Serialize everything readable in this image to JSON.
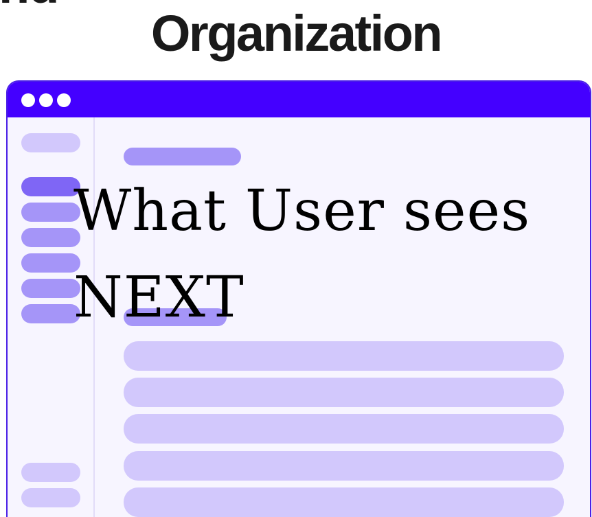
{
  "heading": {
    "cut_off_line": "nd",
    "title": "Organization"
  },
  "overlay": {
    "line1": "What User sees",
    "line2": "NEXT"
  },
  "colors": {
    "titlebar": "#4400ff",
    "window_border": "#4a1fe6",
    "window_background": "#f7f5ff",
    "placeholder_light": "#d2c8fc",
    "placeholder_mid": "#a595f8",
    "placeholder_dark": "#7f66f5"
  }
}
